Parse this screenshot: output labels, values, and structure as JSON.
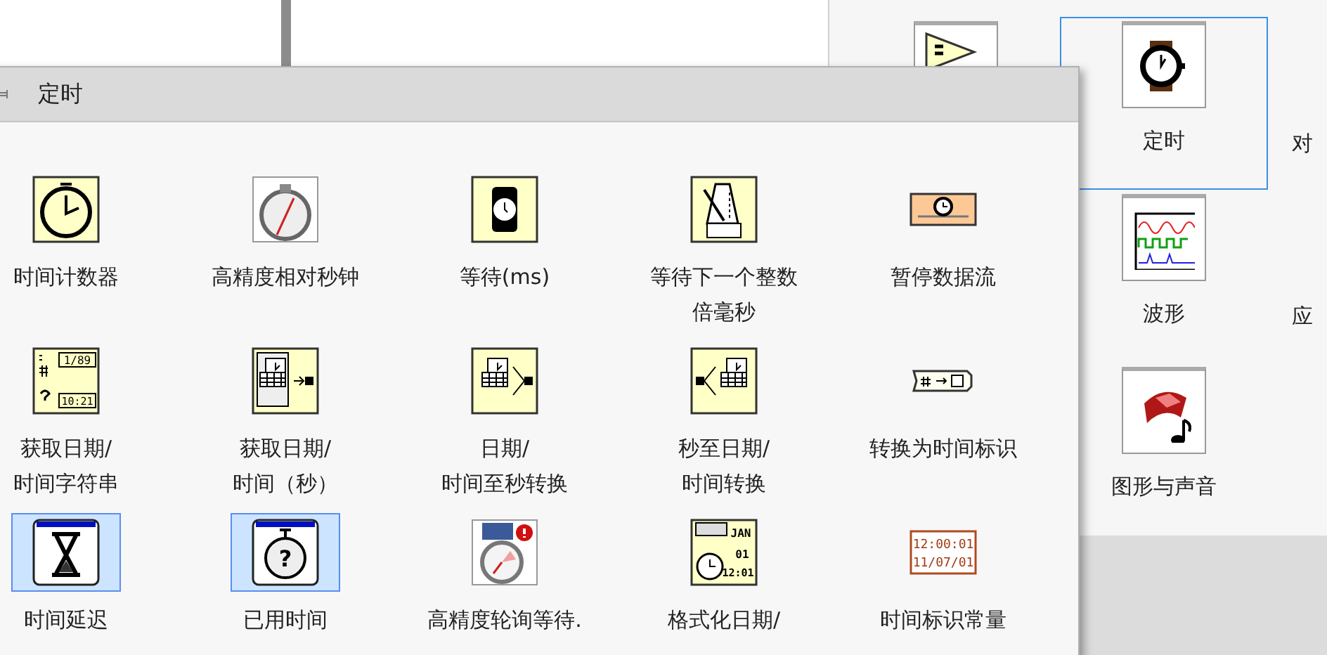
{
  "palette": {
    "rows": [
      [
        {
          "label": "定时",
          "selected": true
        },
        {
          "label": "对",
          "selected": false
        }
      ],
      [
        {
          "label": "波形",
          "selected": false
        },
        {
          "label": "应",
          "selected": false
        }
      ],
      [
        {
          "label": "图形与声音",
          "selected": false
        }
      ]
    ]
  },
  "window": {
    "title": "定时",
    "items": [
      {
        "label_lines": [
          "时间计数器"
        ],
        "selected": false
      },
      {
        "label_lines": [
          "高精度相对秒钟"
        ],
        "selected": false
      },
      {
        "label_lines": [
          "等待(ms)"
        ],
        "selected": false
      },
      {
        "label_lines": [
          "等待下一个整数",
          "倍毫秒"
        ],
        "selected": false
      },
      {
        "label_lines": [
          "暂停数据流"
        ],
        "selected": false
      },
      {
        "label_lines": [
          "获取日期/",
          "时间字符串"
        ],
        "selected": false,
        "icon_text": [
          "1/89",
          "10:21"
        ]
      },
      {
        "label_lines": [
          "获取日期/",
          "时间（秒）"
        ],
        "selected": false
      },
      {
        "label_lines": [
          "日期/",
          "时间至秒转换"
        ],
        "selected": false
      },
      {
        "label_lines": [
          "秒至日期/",
          "时间转换"
        ],
        "selected": false
      },
      {
        "label_lines": [
          "转换为时间标识"
        ],
        "selected": false
      },
      {
        "label_lines": [
          "时间延迟"
        ],
        "selected": true
      },
      {
        "label_lines": [
          "已用时间"
        ],
        "selected": true,
        "icon_text": [
          "?"
        ]
      },
      {
        "label_lines": [
          "高精度轮询等待."
        ],
        "selected": false
      },
      {
        "label_lines": [
          "格式化日期/"
        ],
        "selected": false,
        "icon_text": [
          "JAN",
          "01",
          "12:01"
        ]
      },
      {
        "label_lines": [
          "时间标识常量"
        ],
        "selected": false,
        "icon_text": [
          "12:00:01",
          "11/07/01"
        ]
      }
    ]
  }
}
